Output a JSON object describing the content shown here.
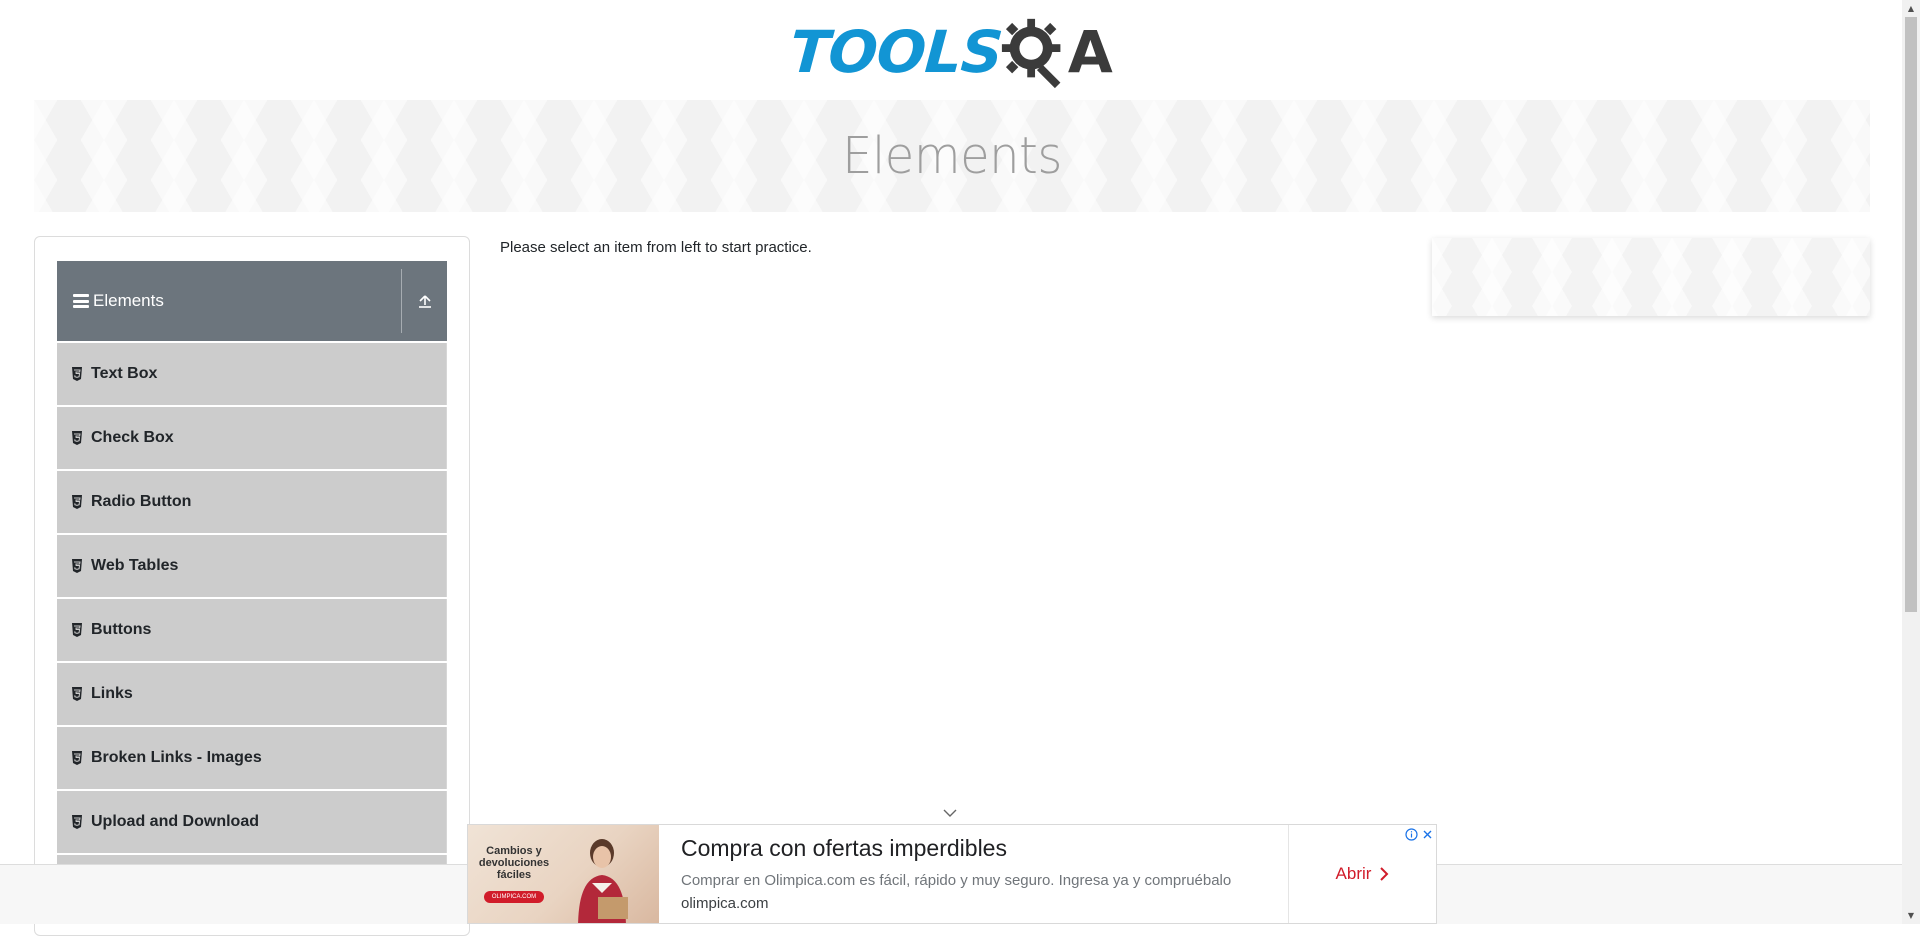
{
  "header": {
    "logo_primary": "TOOLS",
    "logo_secondary": "A",
    "brand_color": "#1295d4",
    "logo_dark_color": "#3b3b3b"
  },
  "banner": {
    "title": "Elements"
  },
  "sidebar": {
    "group_title": "Elements",
    "group_icon": "menu-icon",
    "collapse_icon": "collapse-up-icon",
    "header_color": "#6c757d",
    "item_color": "#cccccc",
    "items": [
      {
        "label": "Text Box",
        "icon": "html5-icon"
      },
      {
        "label": "Check Box",
        "icon": "html5-icon"
      },
      {
        "label": "Radio Button",
        "icon": "html5-icon"
      },
      {
        "label": "Web Tables",
        "icon": "html5-icon"
      },
      {
        "label": "Buttons",
        "icon": "html5-icon"
      },
      {
        "label": "Links",
        "icon": "html5-icon"
      },
      {
        "label": "Broken Links - Images",
        "icon": "html5-icon"
      },
      {
        "label": "Upload and Download",
        "icon": "html5-icon"
      }
    ]
  },
  "main": {
    "instruction": "Please select an item from left to start practice."
  },
  "ad": {
    "image_text": "Cambios y devoluciones fáciles",
    "image_logo": "OLIMPICA.COM",
    "headline": "Compra con ofertas imperdibles",
    "description": "Comprar en Olimpica.com es fácil, rápido y muy seguro. Ingresa ya y compruébalo",
    "domain": "olimpica.com",
    "cta_label": "Abrir",
    "cta_color": "#d11c2a",
    "info_icon": "info-icon",
    "close_icon": "close-icon"
  }
}
